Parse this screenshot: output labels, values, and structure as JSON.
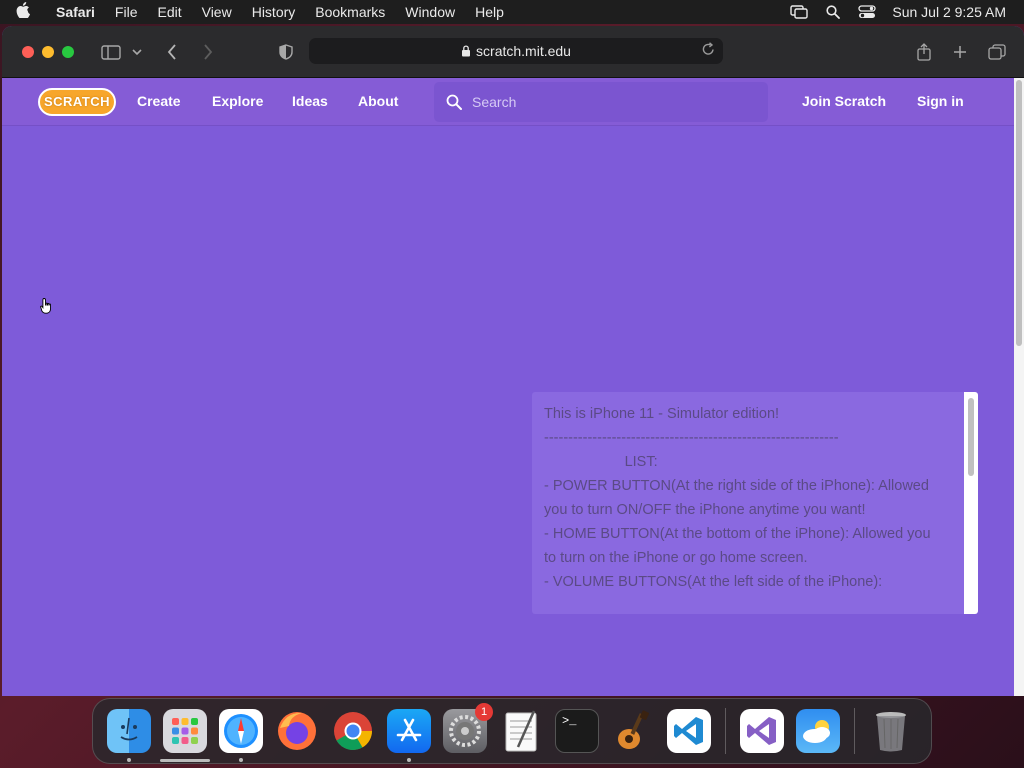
{
  "menubar": {
    "items": [
      "Safari",
      "File",
      "Edit",
      "View",
      "History",
      "Bookmarks",
      "Window",
      "Help"
    ],
    "clock": "Sun Jul 2  9:25 AM"
  },
  "browser": {
    "url": "scratch.mit.edu"
  },
  "nav": {
    "logo": "SCRATCH",
    "links": [
      "Create",
      "Explore",
      "Ideas",
      "About"
    ],
    "search_placeholder": "Search",
    "join": "Join Scratch",
    "signin": "Sign in"
  },
  "panel": {
    "text": "This is iPhone 11 - Simulator edition!\n-------------------------------------------------------------\n                    LIST:\n- POWER BUTTON(At the right side of the iPhone): Allowed you to turn ON/OFF the iPhone anytime you want!\n- HOME BUTTON(At the bottom of the iPhone): Allowed you to turn on the iPhone or go home screen.\n- VOLUME BUTTONS(At the left side of the iPhone):"
  },
  "dock": {
    "items": [
      {
        "name": "finder-icon",
        "label": "Finder"
      },
      {
        "name": "launchpad-icon",
        "label": "Launchpad"
      },
      {
        "name": "safari-icon",
        "label": "Safari"
      },
      {
        "name": "firefox-icon",
        "label": "Firefox"
      },
      {
        "name": "chrome-icon",
        "label": "Chrome"
      },
      {
        "name": "app-store-icon",
        "label": "App Store"
      },
      {
        "name": "system-settings-icon",
        "label": "System Settings"
      },
      {
        "name": "textedit-icon",
        "label": "TextEdit"
      },
      {
        "name": "terminal-icon",
        "label": "Terminal"
      },
      {
        "name": "garageband-icon",
        "label": "GarageBand"
      },
      {
        "name": "vscode-icon",
        "label": "Visual Studio Code"
      },
      {
        "name": "visual-studio-icon",
        "label": "Visual Studio"
      },
      {
        "name": "weather-icon",
        "label": "Weather"
      },
      {
        "name": "trash-icon",
        "label": "Trash"
      }
    ],
    "settings_badge": "1",
    "terminal_glyph": ">_"
  }
}
